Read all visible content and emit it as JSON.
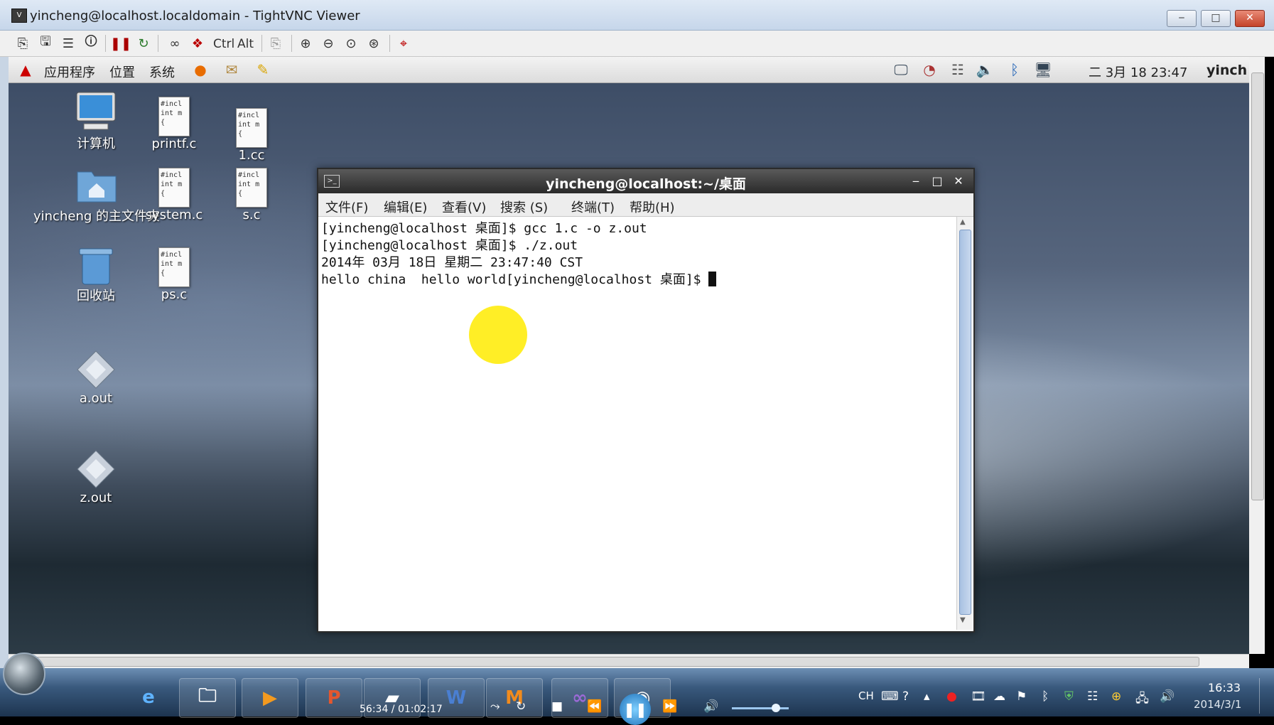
{
  "vnc": {
    "title": "yincheng@localhost.localdomain - TightVNC Viewer",
    "toolbar": {
      "ctrl_label": "Ctrl",
      "alt_label": "Alt"
    }
  },
  "panel": {
    "menus": [
      "应用程序",
      "位置",
      "系统"
    ],
    "clock": "二 3月 18 23:47",
    "user": "yinch"
  },
  "desktop": {
    "icons": [
      {
        "label": "计算机"
      },
      {
        "label": "yincheng 的主文件夹"
      },
      {
        "label": "回收站"
      },
      {
        "label": "a.out"
      },
      {
        "label": "z.out"
      },
      {
        "label": "printf.c"
      },
      {
        "label": "system.c"
      },
      {
        "label": "ps.c"
      },
      {
        "label": "1.cc"
      },
      {
        "label": "s.c"
      }
    ],
    "file_preview": [
      "#incl",
      "int m",
      "{"
    ]
  },
  "terminal": {
    "title": "yincheng@localhost:~/桌面",
    "menus": [
      "文件(F)",
      "编辑(E)",
      "查看(V)",
      "搜索 (S)",
      "终端(T)",
      "帮助(H)"
    ],
    "lines": [
      "[yincheng@localhost 桌面]$ gcc 1.c -o z.out",
      "[yincheng@localhost 桌面]$ ./z.out",
      "2014年 03月 18日 星期二 23:47:40 CST",
      "hello china  hello world[yincheng@localhost 桌面]$ "
    ]
  },
  "taskbar": {
    "player_time": "56:34 / 01:02:17",
    "tray_lang": "CH",
    "time": "16:33",
    "date": "2014/3/1"
  }
}
